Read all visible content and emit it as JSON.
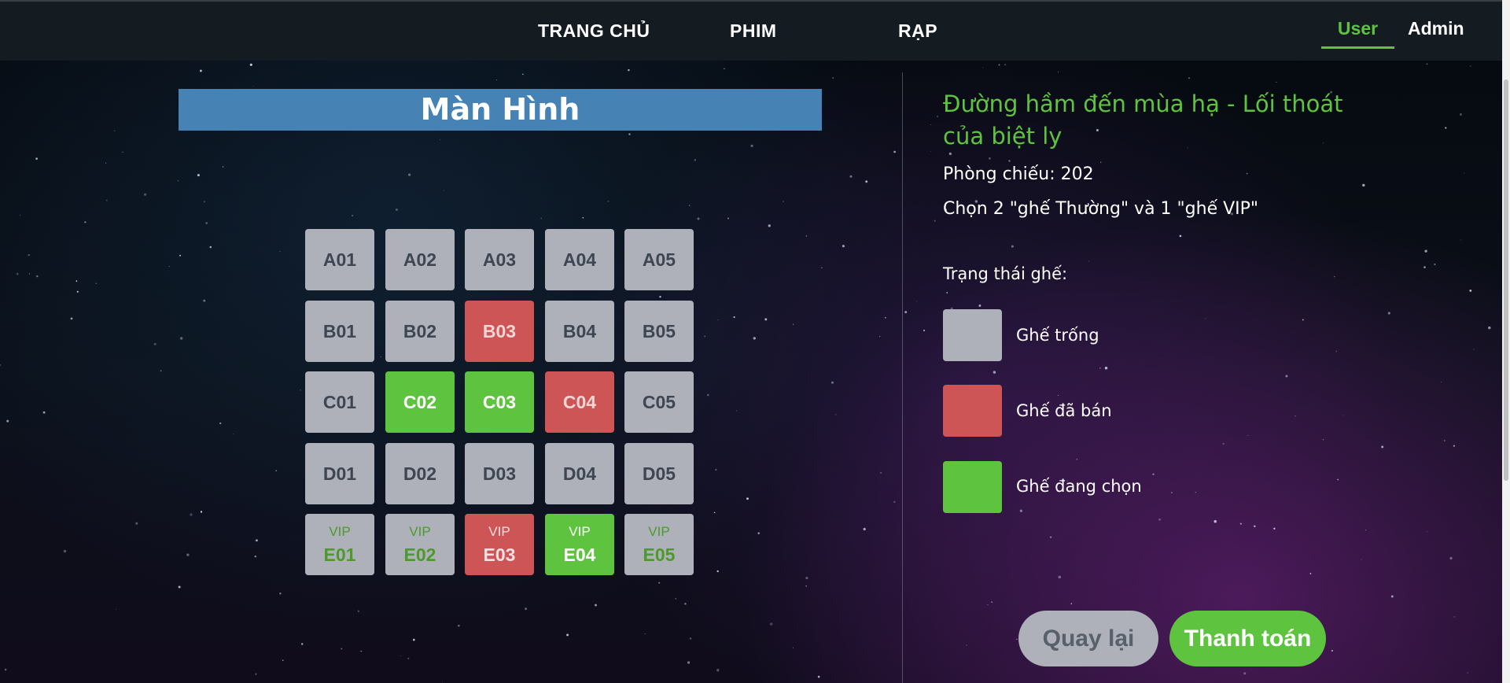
{
  "nav": {
    "links": [
      "TRANG CHỦ",
      "PHIM",
      "RẠP"
    ],
    "user_tab": "User",
    "admin_tab": "Admin"
  },
  "screen_label": "Màn Hình",
  "seats": [
    [
      {
        "code": "A01",
        "status": "empty",
        "tag": ""
      },
      {
        "code": "A02",
        "status": "empty",
        "tag": ""
      },
      {
        "code": "A03",
        "status": "empty",
        "tag": ""
      },
      {
        "code": "A04",
        "status": "empty",
        "tag": ""
      },
      {
        "code": "A05",
        "status": "empty",
        "tag": ""
      }
    ],
    [
      {
        "code": "B01",
        "status": "empty",
        "tag": ""
      },
      {
        "code": "B02",
        "status": "empty",
        "tag": ""
      },
      {
        "code": "B03",
        "status": "sold",
        "tag": ""
      },
      {
        "code": "B04",
        "status": "empty",
        "tag": ""
      },
      {
        "code": "B05",
        "status": "empty",
        "tag": ""
      }
    ],
    [
      {
        "code": "C01",
        "status": "empty",
        "tag": ""
      },
      {
        "code": "C02",
        "status": "chosen",
        "tag": ""
      },
      {
        "code": "C03",
        "status": "chosen",
        "tag": ""
      },
      {
        "code": "C04",
        "status": "sold",
        "tag": ""
      },
      {
        "code": "C05",
        "status": "empty",
        "tag": ""
      }
    ],
    [
      {
        "code": "D01",
        "status": "empty",
        "tag": ""
      },
      {
        "code": "D02",
        "status": "empty",
        "tag": ""
      },
      {
        "code": "D03",
        "status": "empty",
        "tag": ""
      },
      {
        "code": "D04",
        "status": "empty",
        "tag": ""
      },
      {
        "code": "D05",
        "status": "empty",
        "tag": ""
      }
    ],
    [
      {
        "code": "E01",
        "status": "empty",
        "tag": "VIP"
      },
      {
        "code": "E02",
        "status": "empty",
        "tag": "VIP"
      },
      {
        "code": "E03",
        "status": "sold",
        "tag": "VIP"
      },
      {
        "code": "E04",
        "status": "chosen",
        "tag": "VIP"
      },
      {
        "code": "E05",
        "status": "empty",
        "tag": "VIP"
      }
    ]
  ],
  "info": {
    "movie_title": "Đường hầm đến mùa hạ - Lối thoát của biệt ly",
    "room": "Phòng chiếu: 202",
    "selection": "Chọn 2 \"ghế Thường\" và 1 \"ghế VIP\"",
    "status_heading": "Trạng thái ghế:"
  },
  "legend": [
    {
      "label": "Ghế trống",
      "status": "empty"
    },
    {
      "label": "Ghế đã bán",
      "status": "sold"
    },
    {
      "label": "Ghế đang chọn",
      "status": "chosen"
    }
  ],
  "colors": {
    "empty": "#aeb1b9",
    "sold": "#cd5555",
    "chosen": "#5ec43f",
    "accent": "#5ec43f",
    "screen": "#4682b4"
  },
  "buttons": {
    "back": "Quay lại",
    "pay": "Thanh toán"
  }
}
